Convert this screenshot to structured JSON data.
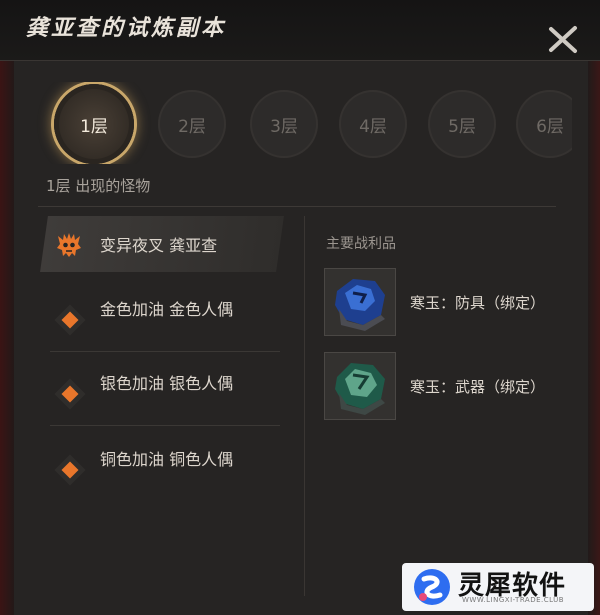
{
  "header": {
    "title": "龚亚查的试炼副本"
  },
  "floors": {
    "items": [
      {
        "label": "1层",
        "active": true
      },
      {
        "label": "2层",
        "active": false
      },
      {
        "label": "3层",
        "active": false
      },
      {
        "label": "4层",
        "active": false
      },
      {
        "label": "5层",
        "active": false
      },
      {
        "label": "6层",
        "active": false
      }
    ],
    "caption": "1层 出现的怪物"
  },
  "monsters": [
    {
      "name": "变异夜叉 龚亚查",
      "icon": "boss-skull-icon",
      "active": true
    },
    {
      "name": "金色加油 金色人偶",
      "icon": "orange-diamond-icon"
    },
    {
      "name": "银色加油 银色人偶",
      "icon": "orange-diamond-icon"
    },
    {
      "name": "铜色加油 铜色人偶",
      "icon": "orange-diamond-icon"
    }
  ],
  "loot": {
    "title": "主要战利品",
    "items": [
      {
        "name": "寒玉：防具（绑定）",
        "icon": "blue-jade-stone-icon"
      },
      {
        "name": "寒玉：武器（绑定）",
        "icon": "green-jade-stone-icon"
      }
    ]
  },
  "watermark": {
    "brand": "灵犀软件",
    "url": "WWW.LINGXI-TRADE.CLUB"
  },
  "colors": {
    "accent": "#e9762b",
    "active_ring": "#c9a76a",
    "panel": "#262423"
  }
}
